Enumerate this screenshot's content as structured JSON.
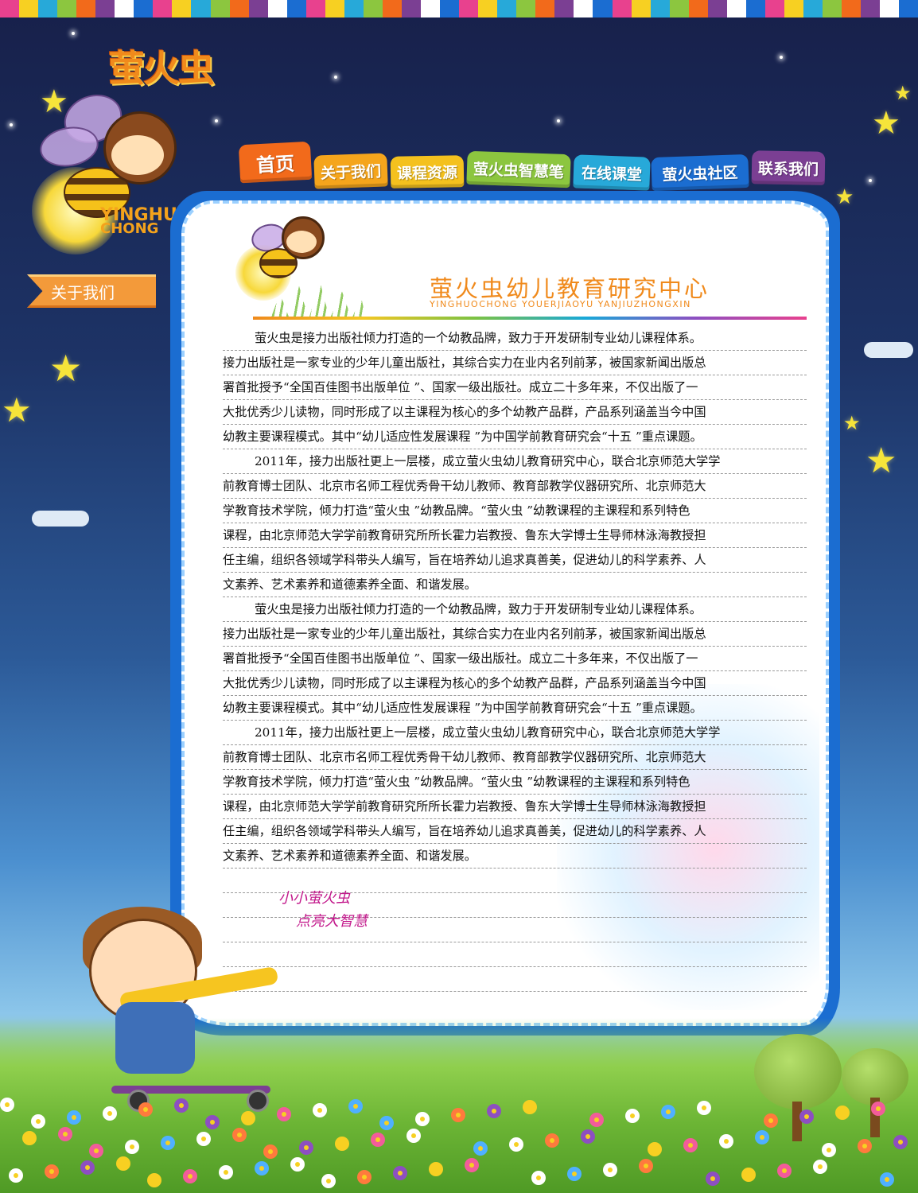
{
  "brand": {
    "logo_text": "萤火虫",
    "pinyin_line1": "YINGHUO",
    "pinyin_line2": "CHONG"
  },
  "side_tag": {
    "label": "关于我们"
  },
  "nav": {
    "items": [
      {
        "label": "首页",
        "color": "#f26a1b"
      },
      {
        "label": "关于我们",
        "color": "#f5a51c"
      },
      {
        "label": "课程资源",
        "color": "#f4c11e"
      },
      {
        "label": "萤火虫智慧笔",
        "color": "#8cc63f"
      },
      {
        "label": "在线课堂",
        "color": "#27a9d9"
      },
      {
        "label": "萤火虫社区",
        "color": "#1b6dd1"
      },
      {
        "label": "联系我们",
        "color": "#7b3f93"
      }
    ]
  },
  "content": {
    "heading": "萤火虫幼儿教育研究中心",
    "heading_pinyin": "YINGHUOCHONG  YOUERJIAOYU  YANJIUZHONGXIN",
    "lines": [
      "萤火虫是接力出版社倾力打造的一个幼教品牌，致力于开发研制专业幼儿课程体系。",
      "接力出版社是一家专业的少年儿童出版社，其综合实力在业内名列前茅，被国家新闻出版总",
      "署首批授予“全国百佳图书出版单位 ”、国家一级出版社。成立二十多年来，不仅出版了一",
      "大批优秀少儿读物，同时形成了以主课程为核心的多个幼教产品群，产品系列涵盖当今中国",
      "幼教主要课程模式。其中“幼儿适应性发展课程 ”为中国学前教育研究会“十五 ”重点课题。",
      "2011年，接力出版社更上一层楼，成立萤火虫幼儿教育研究中心，联合北京师范大学学",
      "前教育博士团队、北京市名师工程优秀骨干幼儿教师、教育部教学仪器研究所、北京师范大",
      "学教育技术学院，倾力打造“萤火虫 ”幼教品牌。“萤火虫 ”幼教课程的主课程和系列特色",
      "课程，由北京师范大学学前教育研究所所长霍力岩教授、鲁东大学博士生导师林泳海教授担",
      "任主编，组织各领域学科带头人编写，旨在培养幼儿追求真善美，促进幼儿的科学素养、人",
      "文素养、艺术素养和道德素养全面、和谐发展。",
      "萤火虫是接力出版社倾力打造的一个幼教品牌，致力于开发研制专业幼儿课程体系。",
      "接力出版社是一家专业的少年儿童出版社，其综合实力在业内名列前茅，被国家新闻出版总",
      "署首批授予“全国百佳图书出版单位 ”、国家一级出版社。成立二十多年来，不仅出版了一",
      "大批优秀少儿读物，同时形成了以主课程为核心的多个幼教产品群，产品系列涵盖当今中国",
      "幼教主要课程模式。其中“幼儿适应性发展课程 ”为中国学前教育研究会“十五 ”重点课题。",
      "2011年，接力出版社更上一层楼，成立萤火虫幼儿教育研究中心，联合北京师范大学学",
      "前教育博士团队、北京市名师工程优秀骨干幼儿教师、教育部教学仪器研究所、北京师范大",
      "学教育技术学院，倾力打造“萤火虫 ”幼教品牌。“萤火虫 ”幼教课程的主课程和系列特色",
      "课程，由北京师范大学学前教育研究所所长霍力岩教授、鲁东大学博士生导师林泳海教授担",
      "任主编，组织各领域学科带头人编写，旨在培养幼儿追求真善美，促进幼儿的科学素养、人",
      "文素养、艺术素养和道德素养全面、和谐发展。",
      "",
      "",
      "",
      "",
      ""
    ],
    "indent_lines": [
      0,
      5,
      11,
      16
    ]
  },
  "slogan": {
    "line1": "小小萤火虫",
    "line2": "点亮大智慧"
  },
  "colors": {
    "stripes": [
      "#e8418e",
      "#f7d022",
      "#27a9d9",
      "#8cc63f",
      "#f26a1b",
      "#7b3f93",
      "#ffffff",
      "#1b6dd1"
    ]
  }
}
